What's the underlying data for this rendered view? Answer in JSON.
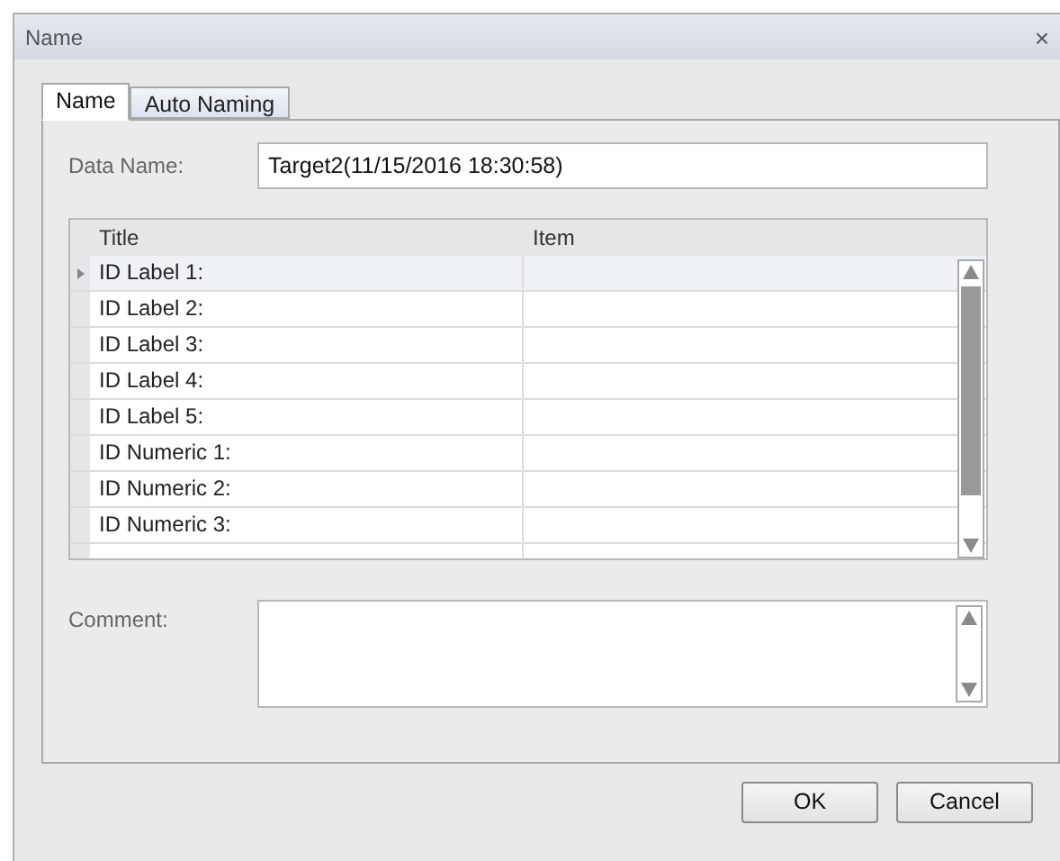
{
  "window": {
    "title": "Name",
    "close": "×"
  },
  "tabs": [
    {
      "label": "Name",
      "selected": true
    },
    {
      "label": "Auto Naming",
      "selected": false
    }
  ],
  "data_name": {
    "label": "Data Name:",
    "value": "Target2(11/15/2016 18:30:58)"
  },
  "table": {
    "columns": [
      "Title",
      "Item"
    ],
    "rows": [
      {
        "title": "ID Label 1:",
        "item": "",
        "selected": true
      },
      {
        "title": "ID Label 2:",
        "item": "",
        "selected": false
      },
      {
        "title": "ID Label 3:",
        "item": "",
        "selected": false
      },
      {
        "title": "ID Label 4:",
        "item": "",
        "selected": false
      },
      {
        "title": "ID Label 5:",
        "item": "",
        "selected": false
      },
      {
        "title": "ID Numeric 1:",
        "item": "",
        "selected": false
      },
      {
        "title": "ID Numeric 2:",
        "item": "",
        "selected": false
      },
      {
        "title": "ID Numeric 3:",
        "item": "",
        "selected": false
      }
    ]
  },
  "comment": {
    "label": "Comment:"
  },
  "buttons": [
    "OK",
    "Cancel"
  ]
}
